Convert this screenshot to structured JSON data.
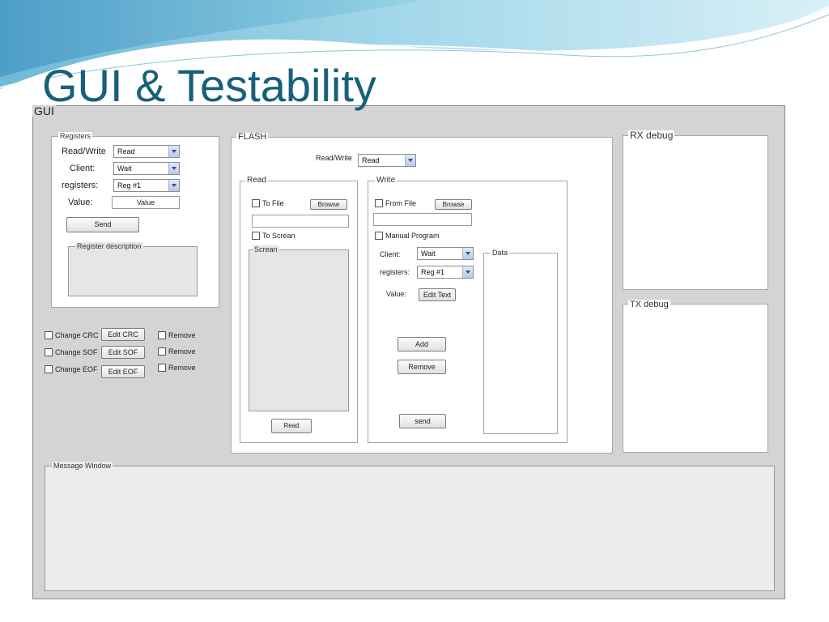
{
  "slide": {
    "title": "GUI & Testability"
  },
  "window": {
    "title": "GUI"
  },
  "registers": {
    "legend": "Registers",
    "read_write_label": "Read/Write",
    "read_write_value": "Read",
    "client_label": "Client:",
    "client_value": "Wait",
    "registers_label": "registers:",
    "registers_value": "Reg #1",
    "value_label": "Value:",
    "value_field": "Value",
    "send_button": "Send",
    "description_legend": "Register description"
  },
  "frame_options": [
    {
      "check_label": "Change CRC",
      "edit_button": "Edit CRC",
      "remove_label": "Remove"
    },
    {
      "check_label": "Change SOF",
      "edit_button": "Edit SOF",
      "remove_label": "Remove"
    },
    {
      "check_label": "Change EOF",
      "edit_button": "Edit EOF",
      "remove_label": "Remove"
    }
  ],
  "flash": {
    "legend": "FLASH",
    "read_write_label": "Read/Write",
    "read_write_value": "Read",
    "read": {
      "legend": "Read",
      "to_file_label": "To File",
      "browse_button": "Browse",
      "to_screen_label": "To Screan",
      "screen_legend": "Screan",
      "read_button": "Read"
    },
    "write": {
      "legend": "Write",
      "from_file_label": "From File",
      "browse_button": "Browse",
      "manual_label": "Manual Program",
      "client_label": "Client:",
      "client_value": "Wait",
      "registers_label": "registers:",
      "registers_value": "Reg #1",
      "value_label": "Value:",
      "edit_text_button": "Edit Text",
      "data_legend": "Data",
      "add_button": "Add",
      "remove_button": "Remove",
      "send_button": "send"
    }
  },
  "rx_debug": {
    "legend": "RX debug"
  },
  "tx_debug": {
    "legend": "TX debug"
  },
  "message_window": {
    "legend": "Message Window"
  }
}
